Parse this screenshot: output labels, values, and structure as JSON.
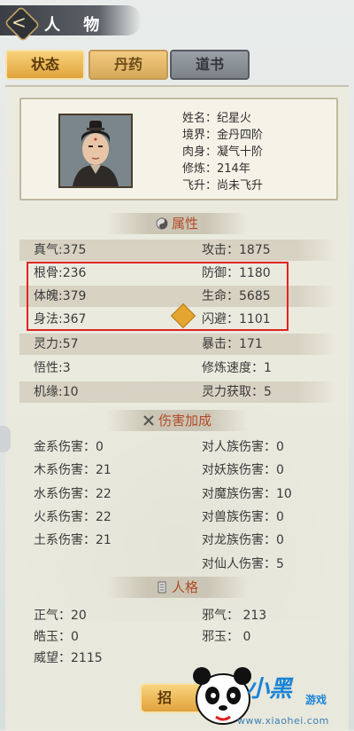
{
  "title": "人 物",
  "tabs": [
    {
      "label": "状态",
      "active": true
    },
    {
      "label": "丹药",
      "active": false
    },
    {
      "label": "道书",
      "active": false
    }
  ],
  "profile": {
    "name": "姓名：纪星火",
    "realm": "境界：金丹四阶",
    "body": "肉身：凝气十阶",
    "cultivation": "修炼：214年",
    "ascension": "飞升：尚未飞升"
  },
  "sections": {
    "attributes": "属性",
    "damage": "伤害加成",
    "personality": "人格"
  },
  "attributes": [
    {
      "left": "真气:375",
      "right": "攻击：1875",
      "shade": true
    },
    {
      "left": "根骨:236",
      "right": "防御：1180",
      "shade": false
    },
    {
      "left": "体魄:379",
      "right": "生命：5685",
      "shade": true
    },
    {
      "left": "身法:367",
      "right": "闪避：1101",
      "shade": false
    },
    {
      "left": "灵力:57",
      "right": "暴击：171",
      "shade": true
    },
    {
      "left": "悟性:3",
      "right": "修炼速度：1",
      "shade": false
    },
    {
      "left": "机缘:10",
      "right": "灵力获取：5",
      "shade": true
    }
  ],
  "damage": [
    {
      "left": "金系伤害：0",
      "right": "对人族伤害：0"
    },
    {
      "left": "木系伤害：21",
      "right": "对妖族伤害：0"
    },
    {
      "left": "水系伤害：22",
      "right": "对魔族伤害：10"
    },
    {
      "left": "火系伤害：22",
      "right": "对兽族伤害：0"
    },
    {
      "left": "土系伤害：21",
      "right": "对龙族伤害：0"
    },
    {
      "left": "",
      "right": "对仙人伤害：5"
    }
  ],
  "personality": [
    {
      "left": "正气：20",
      "right": "邪气：  213"
    },
    {
      "left": "皓玉：0",
      "right": "邪玉：  0"
    },
    {
      "left": "威望：2115",
      "right": ""
    }
  ],
  "bottom_button": "招",
  "watermark": {
    "brand": "小黑",
    "sub": "游戏",
    "url": "www.xiaohei.com"
  },
  "colors": {
    "section_text": "#b44b28",
    "highlight_box": "#e0241f",
    "tab_active": "#e1a33c"
  }
}
